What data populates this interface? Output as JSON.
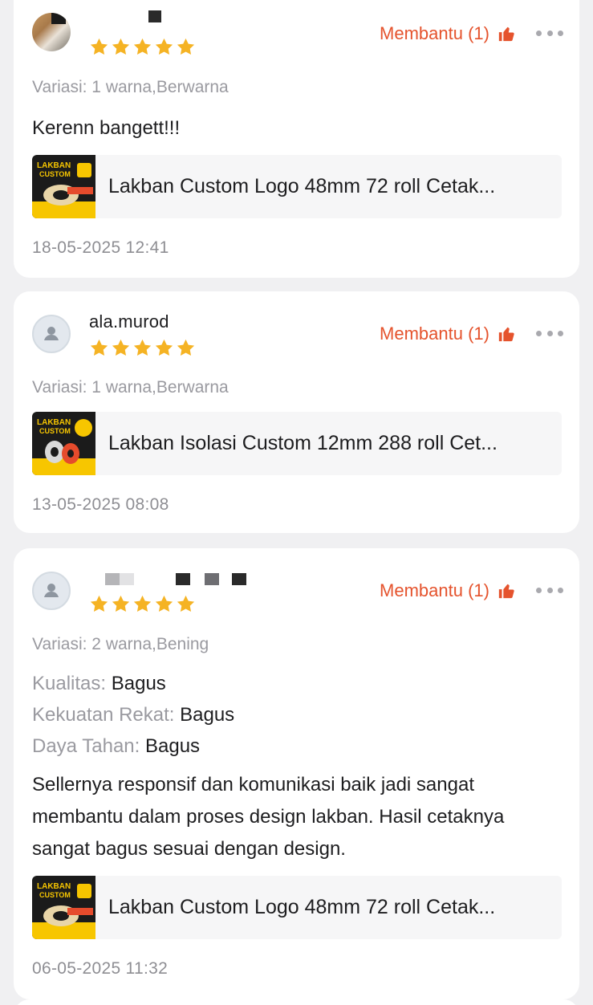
{
  "colors": {
    "accent": "#e5532d",
    "star": "#f5b324",
    "muted": "#9a9aa0",
    "background": "#f0f0f2"
  },
  "reviews": [
    {
      "username": "",
      "avatar": "photo",
      "rating": 5,
      "helpful_label": "Membantu (1)",
      "variant": "Variasi: 1 warna,Berwarna",
      "attributes": [],
      "text": "Kerenn bangett!!!",
      "product": {
        "name": "Lakban Custom Logo 48mm 72 roll Cetak...",
        "thumb_icon": "lakban-custom-product-image"
      },
      "date": "18-05-2025 12:41"
    },
    {
      "username": "ala.murod",
      "avatar": "default-user-icon",
      "rating": 5,
      "helpful_label": "Membantu (1)",
      "variant": "Variasi: 1 warna,Berwarna",
      "attributes": [],
      "text": "",
      "product": {
        "name": "Lakban Isolasi Custom 12mm 288 roll Cet...",
        "thumb_icon": "lakban-custom-product-image"
      },
      "date": "13-05-2025 08:08"
    },
    {
      "username": "",
      "avatar": "default-user-icon",
      "rating": 5,
      "helpful_label": "Membantu (1)",
      "variant": "Variasi: 2 warna,Bening",
      "attributes": [
        {
          "label": "Kualitas:",
          "value": "Bagus"
        },
        {
          "label": "Kekuatan Rekat:",
          "value": "Bagus"
        },
        {
          "label": "Daya Tahan:",
          "value": "Bagus"
        }
      ],
      "text": "Sellernya responsif dan komunikasi baik jadi sangat membantu dalam proses design lakban. Hasil cetaknya sangat bagus sesuai dengan design.",
      "product": {
        "name": "Lakban Custom Logo 48mm 72 roll Cetak...",
        "thumb_icon": "lakban-custom-product-image"
      },
      "date": "06-05-2025 11:32"
    }
  ],
  "icons": {
    "star": "star-icon",
    "helpful": "thumbs-up-icon",
    "more": "more-options-icon"
  }
}
